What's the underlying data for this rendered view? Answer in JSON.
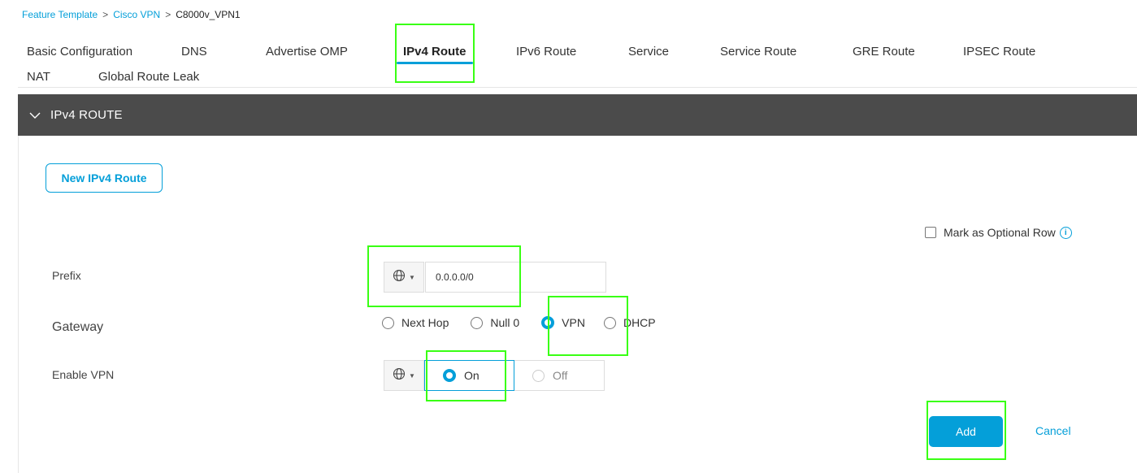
{
  "breadcrumb": {
    "items": [
      "Feature Template",
      "Cisco VPN",
      "C8000v_VPN1"
    ],
    "separator": ">"
  },
  "tabs": [
    {
      "label": "Basic Configuration"
    },
    {
      "label": "DNS"
    },
    {
      "label": "Advertise OMP"
    },
    {
      "label": "IPv4 Route",
      "active": true
    },
    {
      "label": "IPv6 Route"
    },
    {
      "label": "Service"
    },
    {
      "label": "Service Route"
    },
    {
      "label": "GRE Route"
    },
    {
      "label": "IPSEC Route"
    },
    {
      "label": "NAT"
    },
    {
      "label": "Global Route Leak"
    }
  ],
  "section": {
    "title": "IPv4 ROUTE",
    "new_button": "New IPv4 Route",
    "optional_row": {
      "label": "Mark as Optional Row",
      "checked": false
    }
  },
  "form": {
    "prefix": {
      "label": "Prefix",
      "value": "0.0.0.0/0",
      "scope_icon": "globe-icon"
    },
    "gateway": {
      "label": "Gateway",
      "options": [
        "Next Hop",
        "Null 0",
        "VPN",
        "DHCP"
      ],
      "selected": "VPN"
    },
    "enable_vpn": {
      "label": "Enable VPN",
      "on_label": "On",
      "off_label": "Off",
      "selected": "On",
      "scope_icon": "globe-icon"
    }
  },
  "actions": {
    "add": "Add",
    "cancel": "Cancel"
  },
  "colors": {
    "accent": "#049fd9",
    "header_bg": "#4b4b4b",
    "highlight": "#39ff14"
  }
}
